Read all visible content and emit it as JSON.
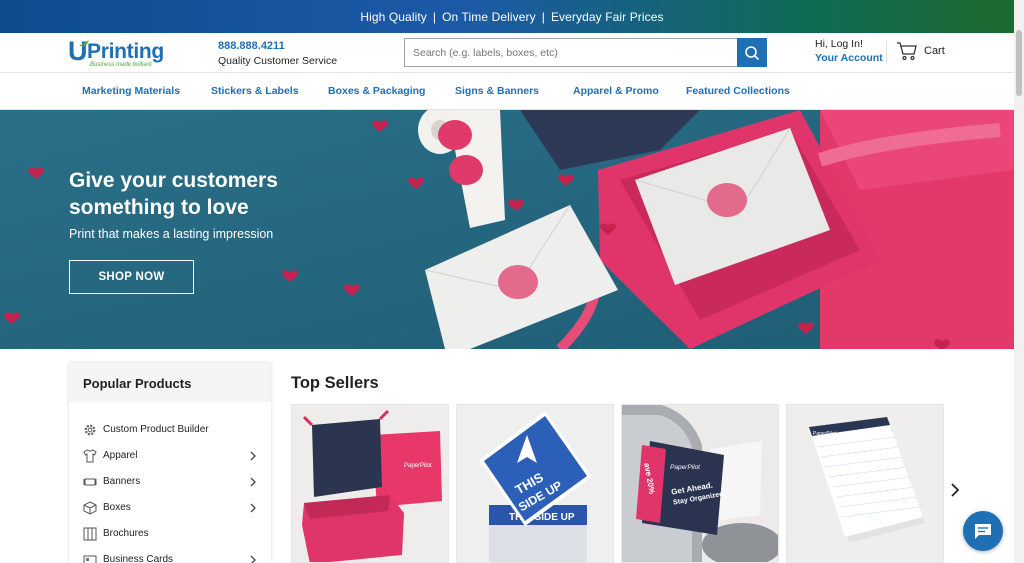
{
  "promo_bar": {
    "item1": "High Quality",
    "item2": "On Time Delivery",
    "item3": "Everyday Fair Prices",
    "separator": "|"
  },
  "header": {
    "logo_text_u": "U",
    "logo_text": "Printing",
    "logo_tagline": "Business made brilliant",
    "phone": "888.888.4211",
    "service": "Quality Customer Service",
    "search_placeholder": "Search (e.g. labels, boxes, etc)",
    "login": "Hi, Log In!",
    "account": "Your Account",
    "cart": "Cart"
  },
  "nav": {
    "items": [
      "Marketing Materials",
      "Stickers & Labels",
      "Boxes & Packaging",
      "Signs & Banners",
      "Apparel & Promo",
      "Featured Collections"
    ]
  },
  "hero": {
    "title": "Give your customers something to love",
    "subtitle": "Print that makes a lasting impression",
    "cta": "SHOP NOW"
  },
  "sidebar": {
    "title": "Popular Products",
    "items": [
      {
        "label": "Custom Product Builder",
        "icon": "gear-icon",
        "has_chevron": false
      },
      {
        "label": "Apparel",
        "icon": "tshirt-icon",
        "has_chevron": true
      },
      {
        "label": "Banners",
        "icon": "banner-icon",
        "has_chevron": true
      },
      {
        "label": "Boxes",
        "icon": "box-icon",
        "has_chevron": true
      },
      {
        "label": "Brochures",
        "icon": "brochure-icon",
        "has_chevron": false
      },
      {
        "label": "Business Cards",
        "icon": "card-icon",
        "has_chevron": true
      }
    ]
  },
  "top_sellers": {
    "title": "Top Sellers",
    "card_texts": {
      "sign_line1": "THIS",
      "sign_line2": "SIDE UP",
      "sign_back": "THIS SIDE UP",
      "box_brand": "PaperPilot",
      "postcard_brand": "PaperPilot",
      "postcard_line1": "Get Ahead.",
      "postcard_line2": "Stay Organized",
      "postcard_side": "ave 20%",
      "notepad_brand": "PaperPilot"
    }
  },
  "colors": {
    "brand_blue": "#1f6fb5",
    "logo_green": "#5aa53a",
    "hero_teal": "#2e6f87",
    "accent_pink": "#e0356a"
  }
}
